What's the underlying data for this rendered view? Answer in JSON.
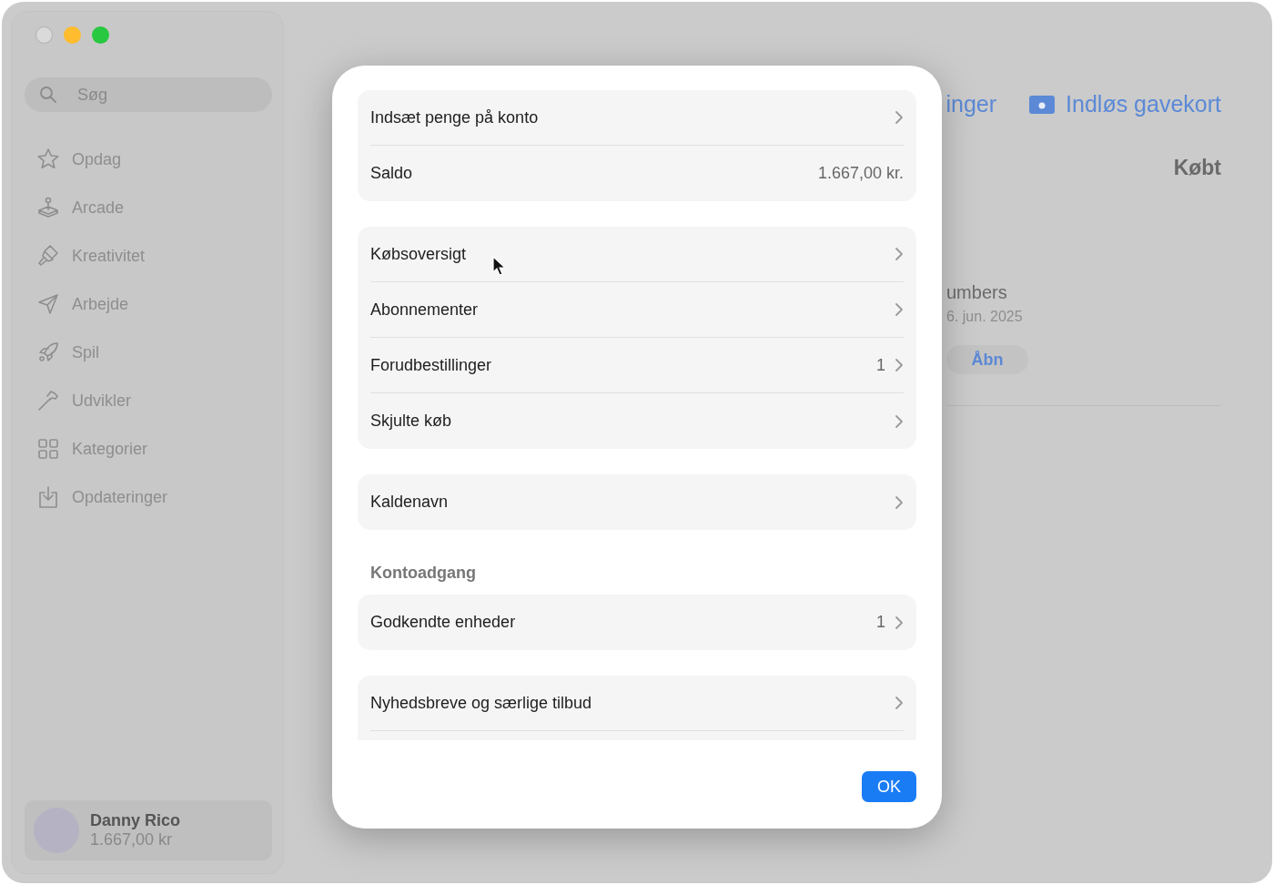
{
  "window": {
    "controls": [
      {
        "kind": "close",
        "disabled": true
      },
      {
        "kind": "minimize",
        "disabled": false
      },
      {
        "kind": "zoom",
        "disabled": false
      }
    ]
  },
  "sidebar": {
    "search": {
      "placeholder": "Søg"
    },
    "items": [
      {
        "label": "Opdag",
        "kind": "star"
      },
      {
        "label": "Arcade",
        "kind": "joystick"
      },
      {
        "label": "Kreativitet",
        "kind": "brush"
      },
      {
        "label": "Arbejde",
        "kind": "plane"
      },
      {
        "label": "Spil",
        "kind": "rocket"
      },
      {
        "label": "Udvikler",
        "kind": "hammer"
      },
      {
        "label": "Kategorier",
        "kind": "grid"
      },
      {
        "label": "Opdateringer",
        "kind": "download"
      }
    ],
    "account": {
      "name": "Danny Rico",
      "balance": "1.667,00 kr"
    }
  },
  "main": {
    "header_links": [
      {
        "label": "inger",
        "kind": "text"
      },
      {
        "label": "Indløs gavekort",
        "kind": "giftcard"
      }
    ],
    "heading": "Købt",
    "app": {
      "name": "umbers",
      "date": "6. jun. 2025",
      "button": "Åbn"
    }
  },
  "dialog": {
    "groups": [
      {
        "rows": [
          {
            "label": "Indsæt penge på konto",
            "kind": "link"
          },
          {
            "label": "Saldo",
            "value": "1.667,00 kr.",
            "kind": "value"
          }
        ]
      },
      {
        "rows": [
          {
            "label": "Købsoversigt",
            "kind": "link"
          },
          {
            "label": "Abonnementer",
            "kind": "link"
          },
          {
            "label": "Forudbestillinger",
            "value": "1",
            "kind": "link"
          },
          {
            "label": "Skjulte køb",
            "kind": "link"
          }
        ]
      },
      {
        "rows": [
          {
            "label": "Kaldenavn",
            "kind": "link"
          }
        ]
      },
      {
        "heading": "Kontoadgang",
        "rows": [
          {
            "label": "Godkendte enheder",
            "value": "1",
            "kind": "link"
          }
        ]
      },
      {
        "continues": true,
        "rows": [
          {
            "label": "Nyhedsbreve og særlige tilbud",
            "kind": "link"
          }
        ]
      }
    ],
    "ok_button": "OK"
  }
}
